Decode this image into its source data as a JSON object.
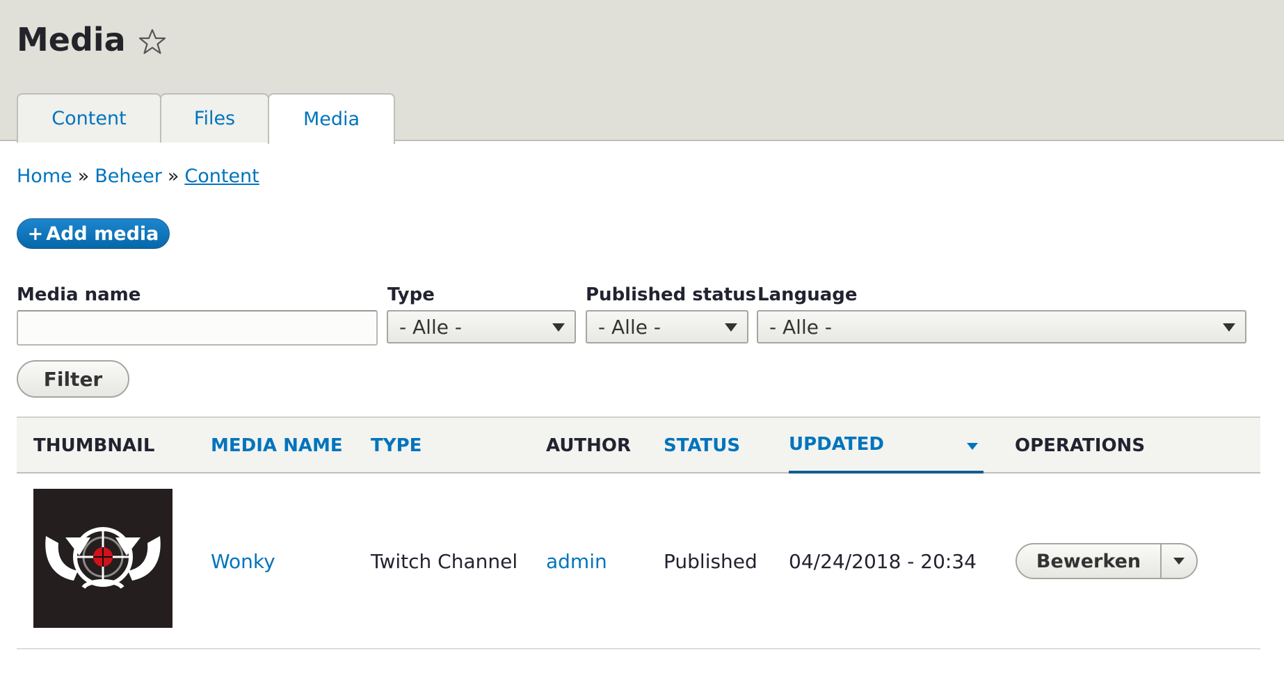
{
  "header": {
    "title": "Media",
    "tabs": [
      {
        "label": "Content"
      },
      {
        "label": "Files"
      },
      {
        "label": "Media"
      }
    ]
  },
  "breadcrumb": {
    "items": [
      "Home",
      "Beheer",
      "Content"
    ],
    "separator": "»"
  },
  "actions": {
    "add_media_plus": "+",
    "add_media_label": "Add media"
  },
  "filters": {
    "media_name_label": "Media name",
    "media_name_value": "",
    "type_label": "Type",
    "type_value": "- Alle -",
    "status_label": "Published status",
    "status_value": "- Alle -",
    "language_label": "Language",
    "language_value": "- Alle -",
    "filter_button": "Filter"
  },
  "table": {
    "columns": [
      "Thumbnail",
      "Media name",
      "Type",
      "Author",
      "Status",
      "Updated",
      "Operations"
    ],
    "rows": [
      {
        "media_name": "Wonky",
        "type": "Twitch Channel",
        "author": "admin",
        "status": "Published",
        "updated": "04/24/2018 - 20:34",
        "operation": "Bewerken"
      }
    ]
  },
  "colors": {
    "link": "#0074bd",
    "header_bg": "#e0e0d8",
    "primary_button": "#0071b8"
  }
}
